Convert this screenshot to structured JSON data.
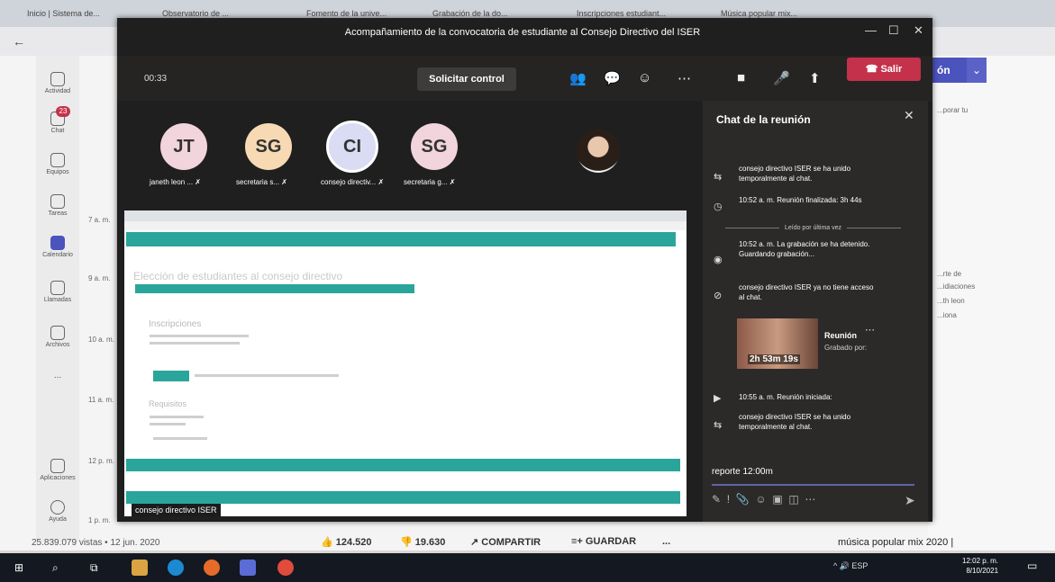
{
  "browser": {
    "tabs": [
      "Inicio | Sistema de...",
      "Observatorio de ...",
      "Fomento de la unive...",
      "Grabación de la do...",
      "Inscripciones estudiant...",
      "Música popular mix..."
    ],
    "back_icon": "arrow-left-icon"
  },
  "teams_rail": {
    "items": [
      {
        "label": "Actividad",
        "icon": "bell-icon"
      },
      {
        "label": "Chat",
        "icon": "chat-icon",
        "badge": "23"
      },
      {
        "label": "Equipos",
        "icon": "teams-icon"
      },
      {
        "label": "Tareas",
        "icon": "tasks-icon"
      },
      {
        "label": "Calendario",
        "icon": "calendar-icon"
      },
      {
        "label": "Llamadas",
        "icon": "phone-icon"
      },
      {
        "label": "Archivos",
        "icon": "file-icon"
      },
      {
        "label": "...",
        "icon": "more-icon"
      },
      {
        "label": "Aplicaciones",
        "icon": "apps-icon"
      },
      {
        "label": "Ayuda",
        "icon": "help-icon"
      }
    ],
    "times": [
      "7 a. m.",
      "9 a. m.",
      "10 a. m.",
      "11 a. m.",
      "12 p. m.",
      "1 p. m."
    ]
  },
  "bg_right": {
    "button_label": "ón",
    "texts": [
      "...porar tu",
      "...rte de",
      "...idiaciones",
      "...th leon",
      "...iona"
    ]
  },
  "youtube_bar": {
    "views": "25.839.079 vistas • 12 jun. 2020",
    "likes": "124.520",
    "dislikes": "19.630",
    "share": "COMPARTIR",
    "save": "GUARDAR",
    "more": "...",
    "next_title": "música popular mix 2020 |"
  },
  "meeting": {
    "title": "Acompañamiento de la convocatoria de estudiante al Consejo Directivo del ISER",
    "timer": "00:33",
    "request_control": "Solicitar control",
    "leave": "Salir",
    "participants": [
      {
        "initials": "JT",
        "name": "janeth leon ...",
        "color": "#f2d4dc"
      },
      {
        "initials": "SG",
        "name": "secretaria s...",
        "color": "#f7d9b3"
      },
      {
        "initials": "CI",
        "name": "consejo directiv...",
        "color": "#d9dcf3"
      },
      {
        "initials": "SG",
        "name": "secretaria g...",
        "color": "#f2d4dc"
      }
    ],
    "shared_screen": {
      "heading": "Elección de estudiantes al consejo directivo",
      "section1": "Inscripciones",
      "section2": "Requisitos",
      "presenter_label": "consejo directivo ISER"
    }
  },
  "chat": {
    "title": "Chat de la reunión",
    "last_read": "Leído por última vez",
    "messages": [
      {
        "icon": "join-icon",
        "text": "consejo directivo ISER se ha unido temporalmente al chat."
      },
      {
        "icon": "meeting-ended-icon",
        "text": "10:52 a. m.  Reunión finalizada: 3h 44s"
      },
      {
        "icon": "record-icon",
        "text": "10:52 a. m.  La grabación se ha detenido. Guardando grabación..."
      },
      {
        "icon": "no-access-icon",
        "text": "consejo directivo ISER ya no tiene acceso al chat."
      },
      {
        "icon": "meeting-start-icon",
        "text": "10:55 a. m.  Reunión iniciada:"
      },
      {
        "icon": "join-icon",
        "text": "consejo directivo ISER se ha unido temporalmente al chat."
      }
    ],
    "recording": {
      "duration": "2h 53m 19s",
      "title": "Reunión",
      "subtitle": "Grabado por:"
    },
    "compose_text": "reporte 12:00m"
  },
  "taskbar": {
    "tray": "^ 🔊 ESP",
    "time": "12:02 p. m.",
    "date": "8/10/2021"
  }
}
